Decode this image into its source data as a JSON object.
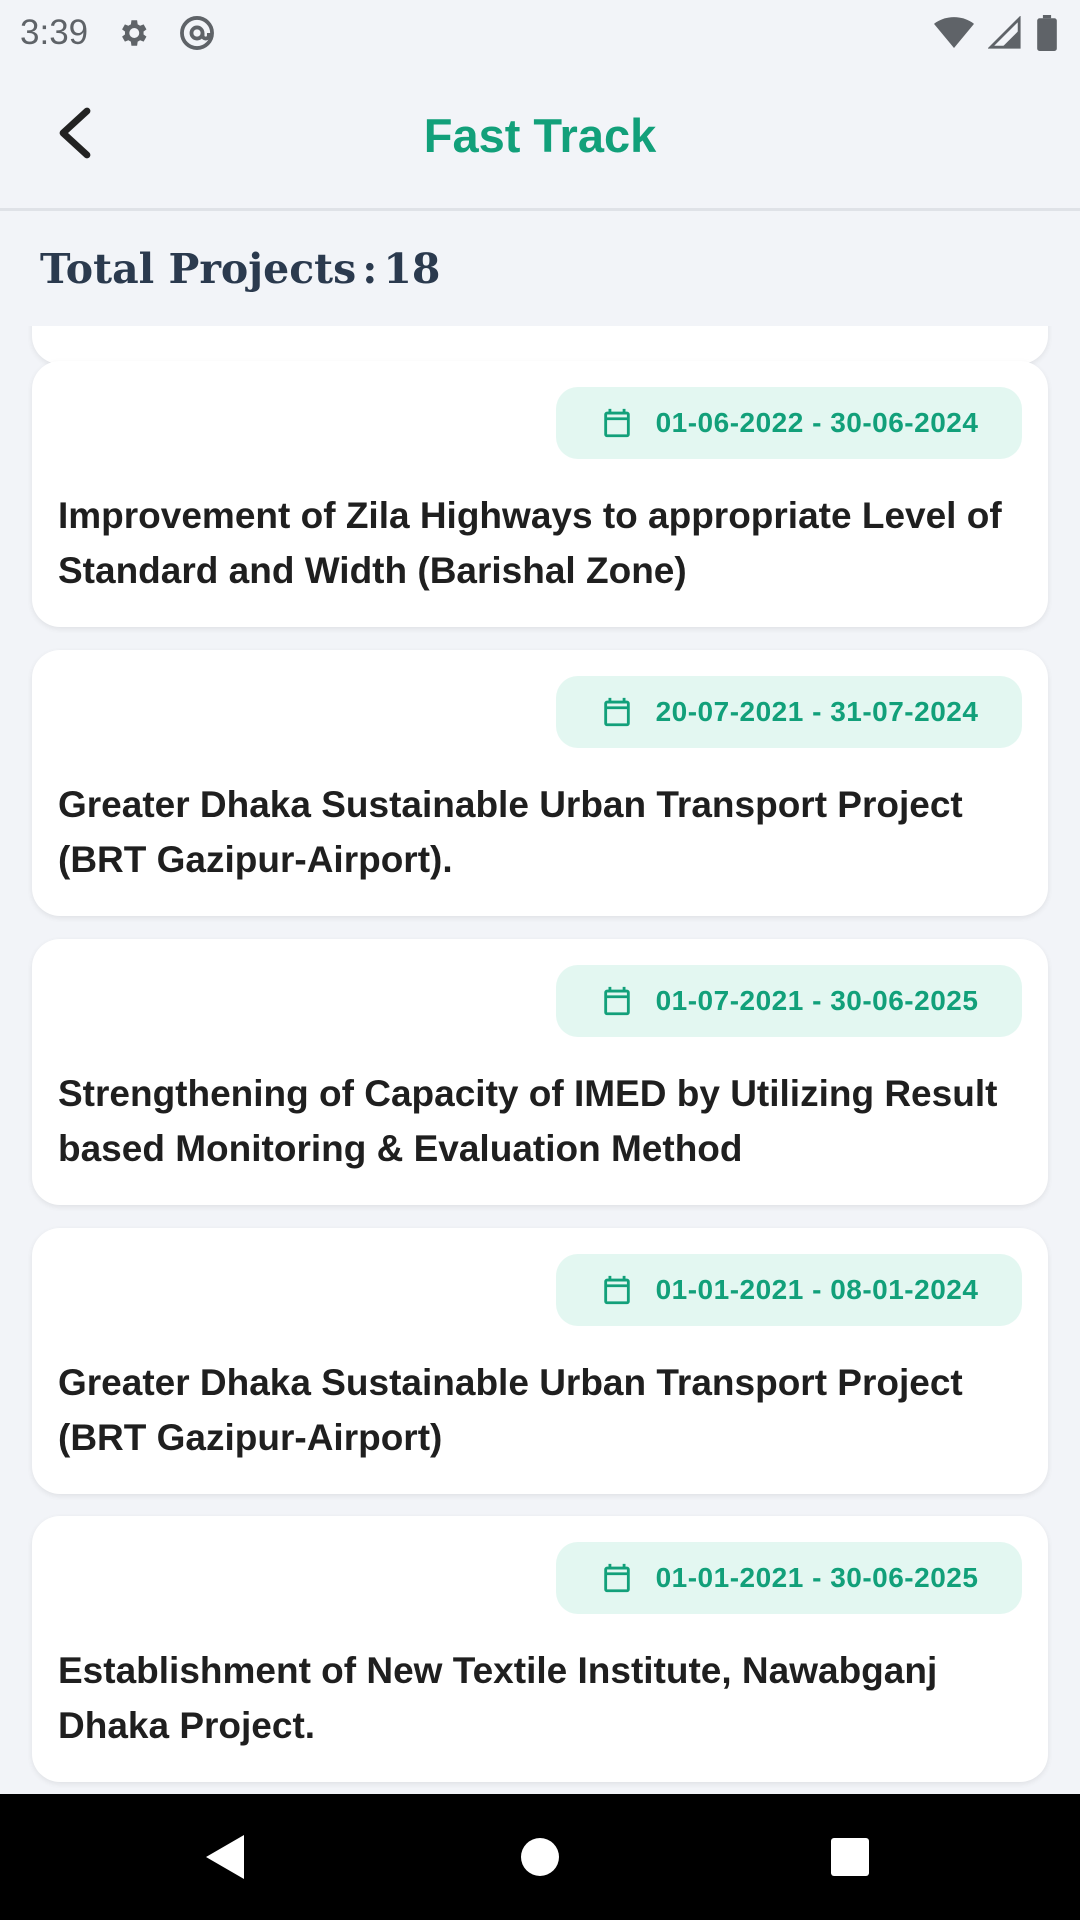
{
  "status_bar": {
    "time": "3:39",
    "icons": [
      "settings-icon",
      "at-sign-icon",
      "wifi-icon",
      "signal-icon",
      "battery-icon"
    ]
  },
  "app_bar": {
    "title": "Fast Track",
    "back_icon": "chevron-left-icon"
  },
  "summary": {
    "label": "Total Projects",
    "separator": ":",
    "count": "18"
  },
  "projects": [
    {
      "date_range": "01-06-2022 - 30-06-2024",
      "title": "Improvement of Zila Highways to appropriate Level of Standard and Width (Barishal Zone)"
    },
    {
      "date_range": "20-07-2021 - 31-07-2024",
      "title": "Greater Dhaka Sustainable Urban Transport Project (BRT Gazipur-Airport)."
    },
    {
      "date_range": "01-07-2021 - 30-06-2025",
      "title": "Strengthening of Capacity of IMED by Utilizing Result based Monitoring & Evaluation Method"
    },
    {
      "date_range": "01-01-2021 - 08-01-2024",
      "title": "Greater Dhaka Sustainable Urban Transport Project (BRT Gazipur-Airport)"
    },
    {
      "date_range": "01-01-2021 - 30-06-2025",
      "title": "Establishment of New Textile Institute, Nawabganj Dhaka Project."
    }
  ],
  "colors": {
    "accent": "#12a07a",
    "pill_bg": "#e3f7f1",
    "page_bg": "#f2f4f8",
    "heading": "#2b3a4e"
  },
  "nav_bar": {
    "icons": [
      "back-triangle-icon",
      "home-circle-icon",
      "recents-square-icon"
    ]
  }
}
